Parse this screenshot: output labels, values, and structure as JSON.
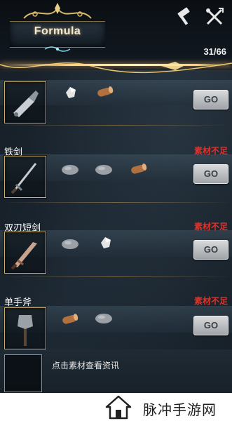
{
  "header": {
    "title": "Formula",
    "progress": "31/66",
    "icons": [
      "hammer-icon",
      "crossed-tools-icon"
    ]
  },
  "recipes": [
    {
      "name": "",
      "status": "",
      "item_icon": "armor-piece-icon",
      "materials": [
        "crystal-shard-icon",
        "wood-log-icon"
      ],
      "go_label": "GO"
    },
    {
      "name": "铁剑",
      "status": "素材不足",
      "item_icon": "iron-sword-icon",
      "materials": [
        "stone-icon",
        "stone-icon",
        "wood-log-icon"
      ],
      "go_label": "GO"
    },
    {
      "name": "双刃短剑",
      "status": "素材不足",
      "item_icon": "double-edged-dagger-icon",
      "materials": [
        "stone-icon",
        "crystal-shard-icon"
      ],
      "go_label": "GO"
    },
    {
      "name": "单手斧",
      "status": "素材不足",
      "item_icon": "one-handed-axe-icon",
      "materials": [
        "wood-log-icon",
        "stone-icon"
      ],
      "go_label": "GO"
    }
  ],
  "info": {
    "hint": "点击素材查看资讯"
  },
  "footer": {
    "brand": "脉冲手游网",
    "icon": "home-icon"
  },
  "colors": {
    "warning": "#e0322b",
    "gold": "#ffd47a",
    "background": "#141c24"
  }
}
